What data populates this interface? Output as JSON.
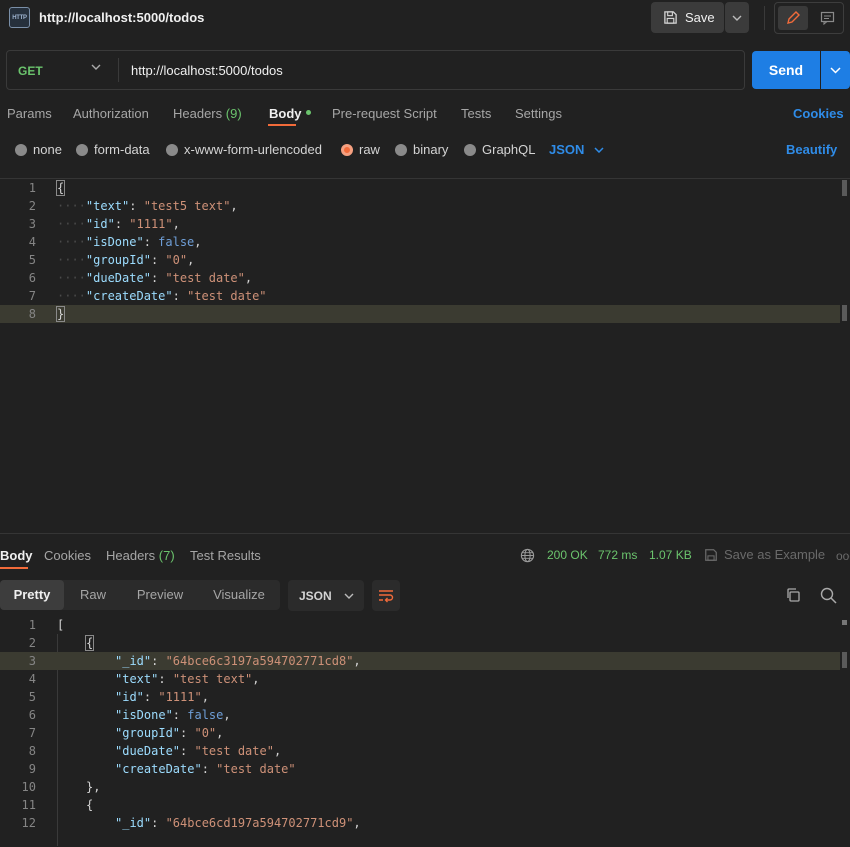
{
  "titlebar": {
    "badge": "HTTP",
    "title": "http://localhost:5000/todos",
    "save_label": "Save"
  },
  "request": {
    "method": "GET",
    "url": "http://localhost:5000/todos",
    "send_label": "Send"
  },
  "request_tabs": {
    "params": "Params",
    "authorization": "Authorization",
    "headers": "Headers",
    "headers_count": "(9)",
    "body": "Body",
    "prerequest": "Pre-request Script",
    "tests": "Tests",
    "settings": "Settings",
    "cookies": "Cookies"
  },
  "body_types": {
    "none": "none",
    "form_data": "form-data",
    "urlencoded": "x-www-form-urlencoded",
    "raw": "raw",
    "binary": "binary",
    "graphql": "GraphQL",
    "selected": "raw",
    "language": "JSON",
    "beautify": "Beautify"
  },
  "request_body": {
    "line_numbers": [
      "1",
      "2",
      "3",
      "4",
      "5",
      "6",
      "7",
      "8"
    ],
    "open": "{",
    "close": "}",
    "fields": [
      {
        "key": "\"text\"",
        "value": "\"test5 text\"",
        "sep": ","
      },
      {
        "key": "\"id\"",
        "value": "\"1111\"",
        "sep": ","
      },
      {
        "key": "\"isDone\"",
        "value": "false",
        "sep": ","
      },
      {
        "key": "\"groupId\"",
        "value": "\"0\"",
        "sep": ","
      },
      {
        "key": "\"dueDate\"",
        "value": "\"test date\"",
        "sep": ","
      },
      {
        "key": "\"createDate\"",
        "value": "\"test date\"",
        "sep": ""
      }
    ]
  },
  "response_tabs": {
    "body": "Body",
    "cookies": "Cookies",
    "headers": "Headers",
    "headers_count": "(7)",
    "test_results": "Test Results"
  },
  "response_status": {
    "status": "200 OK",
    "time": "772 ms",
    "size": "1.07 KB",
    "save_example": "Save as Example",
    "more": "ooo"
  },
  "view_modes": {
    "pretty": "Pretty",
    "raw": "Raw",
    "preview": "Preview",
    "visualize": "Visualize",
    "format": "JSON"
  },
  "response_body": {
    "line_numbers": [
      "1",
      "2",
      "3",
      "4",
      "5",
      "6",
      "7",
      "8",
      "9",
      "10",
      "11",
      "12"
    ],
    "array_open": "[",
    "obj_open": "{",
    "obj_close": "},",
    "first": [
      {
        "key": "\"_id\"",
        "value": "\"64bce6c3197a594702771cd8\"",
        "sep": ","
      },
      {
        "key": "\"text\"",
        "value": "\"test text\"",
        "sep": ","
      },
      {
        "key": "\"id\"",
        "value": "\"1111\"",
        "sep": ","
      },
      {
        "key": "\"isDone\"",
        "value": "false",
        "sep": ","
      },
      {
        "key": "\"groupId\"",
        "value": "\"0\"",
        "sep": ","
      },
      {
        "key": "\"dueDate\"",
        "value": "\"test date\"",
        "sep": ","
      },
      {
        "key": "\"createDate\"",
        "value": "\"test date\"",
        "sep": ""
      }
    ],
    "second_first": {
      "key": "\"_id\"",
      "value": "\"64bce6cd197a594702771cd9\"",
      "sep": ","
    }
  },
  "colors": {
    "accent_orange": "#f26b3a",
    "send_blue": "#1e7ee4",
    "link_blue": "#2f8ce8",
    "status_green": "#6bc46d",
    "json_key": "#9cdcfe",
    "json_string": "#ce9178",
    "json_keyword": "#6f9fd8"
  },
  "icons": [
    "http-badge-icon",
    "save-icon",
    "chevron-down-icon",
    "pencil-icon",
    "comment-icon",
    "globe-icon",
    "save-example-icon",
    "copy-icon",
    "search-icon",
    "wrap-lines-icon"
  ]
}
